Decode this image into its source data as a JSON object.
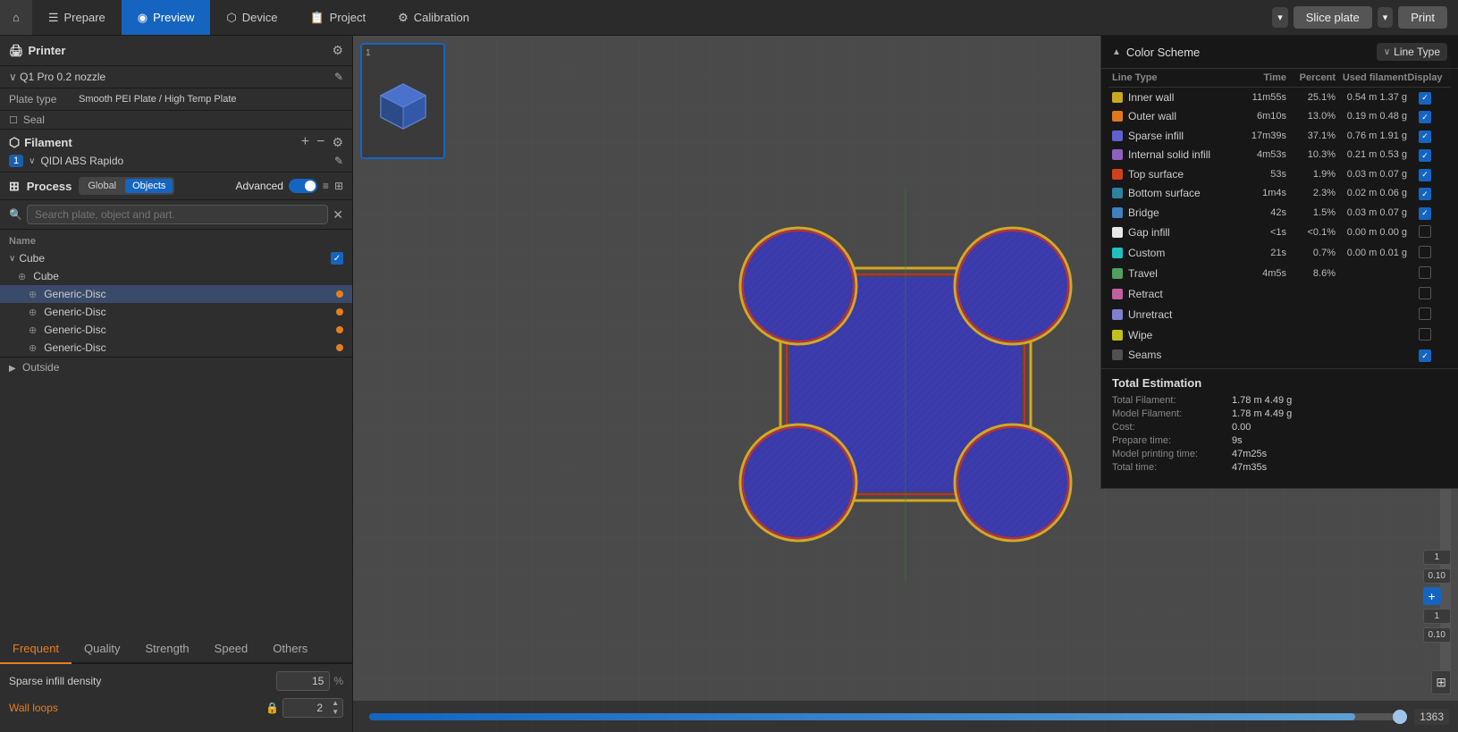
{
  "nav": {
    "home_icon": "⌂",
    "items": [
      {
        "label": "Prepare",
        "icon": "☰",
        "active": false
      },
      {
        "label": "Preview",
        "icon": "◉",
        "active": true
      },
      {
        "label": "Device",
        "icon": "⬡",
        "active": false
      },
      {
        "label": "Project",
        "icon": "📋",
        "active": false
      },
      {
        "label": "Calibration",
        "icon": "⚙",
        "active": false
      }
    ],
    "slice_label": "Slice plate",
    "print_label": "Print"
  },
  "printer": {
    "section_title": "Printer",
    "name": "Q1 Pro 0.2 nozzle",
    "plate_label": "Plate type",
    "plate_value": "Smooth PEI Plate / High Temp Plate",
    "seal_label": "Seal"
  },
  "filament": {
    "section_title": "Filament",
    "badge": "1",
    "name": "QIDI ABS Rapido"
  },
  "process": {
    "section_title": "Process",
    "toggle_global": "Global",
    "toggle_objects": "Objects",
    "advanced_label": "Advanced"
  },
  "search": {
    "placeholder": "Search plate, object and part."
  },
  "tree": {
    "name_header": "Name",
    "items": [
      {
        "label": "Cube",
        "level": 0,
        "type": "group",
        "checked": true
      },
      {
        "label": "Cube",
        "level": 1,
        "type": "part"
      },
      {
        "label": "Generic-Disc",
        "level": 2,
        "type": "part",
        "orange": true
      },
      {
        "label": "Generic-Disc",
        "level": 2,
        "type": "part",
        "orange": true
      },
      {
        "label": "Generic-Disc",
        "level": 2,
        "type": "part",
        "orange": true
      },
      {
        "label": "Generic-Disc",
        "level": 2,
        "type": "part",
        "orange": true
      }
    ],
    "outside_label": "Outside"
  },
  "tabs": {
    "items": [
      {
        "label": "Frequent",
        "active": true
      },
      {
        "label": "Quality",
        "active": false
      },
      {
        "label": "Strength",
        "active": false
      },
      {
        "label": "Speed",
        "active": false
      },
      {
        "label": "Others",
        "active": false
      }
    ]
  },
  "settings": {
    "infill_label": "Sparse infill density",
    "infill_value": "15",
    "infill_unit": "%",
    "wall_label": "Wall loops",
    "wall_value": "2"
  },
  "viewport": {
    "thumbnail_num": "1",
    "layer_count": "1363",
    "progress_pct": 95
  },
  "color_panel": {
    "scheme_title": "Color Scheme",
    "line_type_label": "Line Type",
    "table_headers": {
      "type": "Line Type",
      "time": "Time",
      "percent": "Percent",
      "used": "Used filament",
      "display": "Display"
    },
    "rows": [
      {
        "color": "#c8a820",
        "label": "Inner wall",
        "time": "11m55s",
        "pct": "25.1%",
        "used": "0.54 m  1.37 g",
        "checked": true
      },
      {
        "color": "#e07820",
        "label": "Outer wall",
        "time": "6m10s",
        "pct": "13.0%",
        "used": "0.19 m  0.48 g",
        "checked": true
      },
      {
        "color": "#6060d0",
        "label": "Sparse infill",
        "time": "17m39s",
        "pct": "37.1%",
        "used": "0.76 m  1.91 g",
        "checked": true
      },
      {
        "color": "#9060c0",
        "label": "Internal solid infill",
        "time": "4m53s",
        "pct": "10.3%",
        "used": "0.21 m  0.53 g",
        "checked": true
      },
      {
        "color": "#d04020",
        "label": "Top surface",
        "time": "53s",
        "pct": "1.9%",
        "used": "0.03 m  0.07 g",
        "checked": true
      },
      {
        "color": "#3080a0",
        "label": "Bottom surface",
        "time": "1m4s",
        "pct": "2.3%",
        "used": "0.02 m  0.06 g",
        "checked": true
      },
      {
        "color": "#4080c0",
        "label": "Bridge",
        "time": "42s",
        "pct": "1.5%",
        "used": "0.03 m  0.07 g",
        "checked": true
      },
      {
        "color": "#e8e8e8",
        "label": "Gap infill",
        "time": "<1s",
        "pct": "<0.1%",
        "used": "0.00 m  0.00 g",
        "checked": false
      },
      {
        "color": "#20c0c0",
        "label": "Custom",
        "time": "21s",
        "pct": "0.7%",
        "used": "0.00 m  0.01 g",
        "checked": false
      },
      {
        "color": "#50a060",
        "label": "Travel",
        "time": "4m5s",
        "pct": "8.6%",
        "used": "",
        "checked": false
      },
      {
        "color": "#c060a0",
        "label": "Retract",
        "time": "",
        "pct": "",
        "used": "",
        "checked": false
      },
      {
        "color": "#8080d0",
        "label": "Unretract",
        "time": "",
        "pct": "",
        "used": "",
        "checked": false
      },
      {
        "color": "#c0c020",
        "label": "Wipe",
        "time": "",
        "pct": "",
        "used": "",
        "checked": false
      },
      {
        "color": "#505050",
        "label": "Seams",
        "time": "",
        "pct": "",
        "used": "",
        "checked": true
      }
    ],
    "total": {
      "title": "Total Estimation",
      "rows": [
        {
          "key": "Total Filament:",
          "val": "1.78 m  4.49 g"
        },
        {
          "key": "Model Filament:",
          "val": "1.78 m  4.49 g"
        },
        {
          "key": "Cost:",
          "val": "0.00"
        },
        {
          "key": "Prepare time:",
          "val": "9s"
        },
        {
          "key": "Model printing time:",
          "val": "47m25s"
        },
        {
          "key": "Total time:",
          "val": "47m35s"
        }
      ]
    }
  }
}
